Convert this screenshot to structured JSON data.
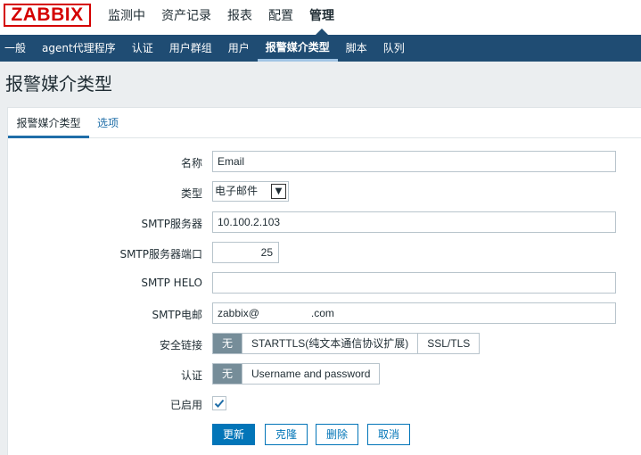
{
  "logo": "ZABBIX",
  "main_menu": [
    {
      "label": "监测中"
    },
    {
      "label": "资产记录"
    },
    {
      "label": "报表"
    },
    {
      "label": "配置"
    },
    {
      "label": "管理"
    }
  ],
  "sub_nav": [
    {
      "label": "一般"
    },
    {
      "label": "agent代理程序"
    },
    {
      "label": "认证"
    },
    {
      "label": "用户群组"
    },
    {
      "label": "用户"
    },
    {
      "label": "报警媒介类型"
    },
    {
      "label": "脚本"
    },
    {
      "label": "队列"
    }
  ],
  "page_title": "报警媒介类型",
  "tabs": [
    {
      "label": "报警媒介类型"
    },
    {
      "label": "选项"
    }
  ],
  "form": {
    "name_label": "名称",
    "name_value": "Email",
    "type_label": "类型",
    "type_value": "电子邮件",
    "smtp_server_label": "SMTP服务器",
    "smtp_server_value": "10.100.2.103",
    "smtp_port_label": "SMTP服务器端口",
    "smtp_port_value": "25",
    "smtp_helo_label": "SMTP HELO",
    "smtp_helo_value": "",
    "smtp_email_label": "SMTP电邮",
    "smtp_email_value": "zabbix@",
    "smtp_email_suffix": ".com",
    "security_label": "安全链接",
    "security_options": [
      "无",
      "STARTTLS(纯文本通信协议扩展)",
      "SSL/TLS"
    ],
    "auth_label": "认证",
    "auth_options": [
      "无",
      "Username and password"
    ],
    "enabled_label": "已启用"
  },
  "buttons": {
    "update": "更新",
    "clone": "克隆",
    "delete": "删除",
    "cancel": "取消"
  }
}
